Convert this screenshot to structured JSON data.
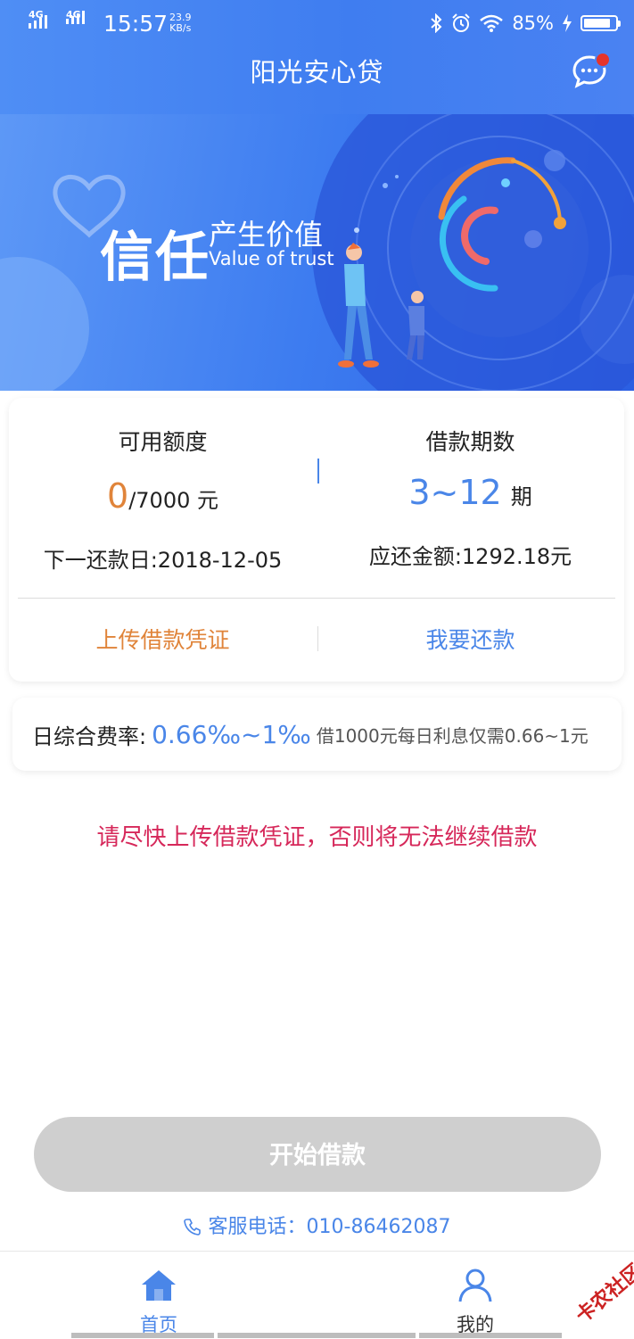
{
  "status_bar": {
    "signal1": "4G",
    "signal2": "4G",
    "time": "15:57",
    "net_speed": "23.9",
    "net_unit": "KB/s",
    "battery": "85%",
    "battery_level": 0.85
  },
  "header": {
    "title": "阳光安心贷"
  },
  "banner": {
    "title": "信任",
    "subtitle": "产生价值",
    "subtitle_en": "Value of trust"
  },
  "card": {
    "quota": {
      "label": "可用额度",
      "used": "0",
      "total": "/7000",
      "unit": "元"
    },
    "period": {
      "label": "借款期数",
      "value": "3~12",
      "unit": "期"
    },
    "next_repay": "下一还款日:2018-12-05",
    "due_amount": "应还金额:1292.18元",
    "upload_label": "上传借款凭证",
    "repay_label": "我要还款"
  },
  "rate": {
    "label": "日综合费率:",
    "value": "0.66‰~1‰",
    "desc": "借1000元每日利息仅需0.66~1元"
  },
  "warning": "请尽快上传借款凭证，否则将无法继续借款",
  "start_button": "开始借款",
  "hotline": "客服电话：010-86462087",
  "tabs": {
    "home": "首页",
    "mine": "我的"
  },
  "watermark": "卡农社区",
  "colors": {
    "primary": "#4a86e8",
    "accent": "#e0843a",
    "warning": "#d6285a",
    "disabled": "#cfcfcf"
  }
}
